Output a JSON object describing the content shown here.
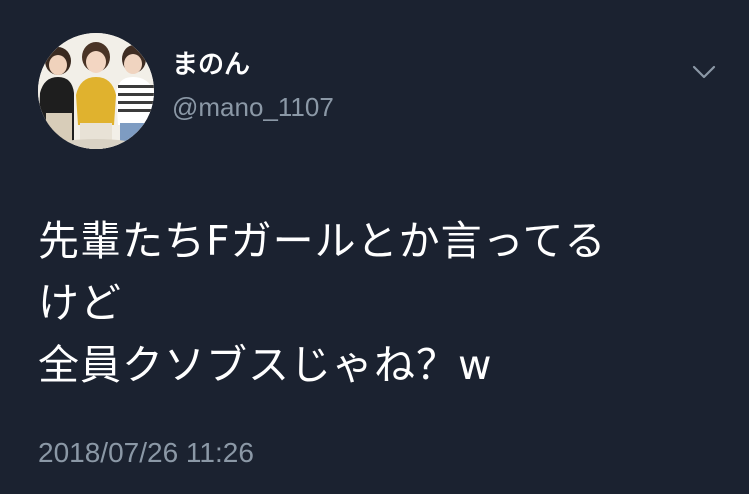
{
  "user": {
    "display_name": "まのん",
    "handle": "@mano_1107"
  },
  "tweet": {
    "lines": [
      "先輩たちFガールとか言ってる",
      "けど",
      "全員クソブスじゃね？w"
    ],
    "timestamp": "2018/07/26 11:26"
  },
  "icons": {
    "menu": "chevron-down-icon",
    "avatar": "profile-photo"
  },
  "colors": {
    "background": "#1b2230",
    "primary_text": "#ffffff",
    "secondary_text": "#8b98a6"
  }
}
